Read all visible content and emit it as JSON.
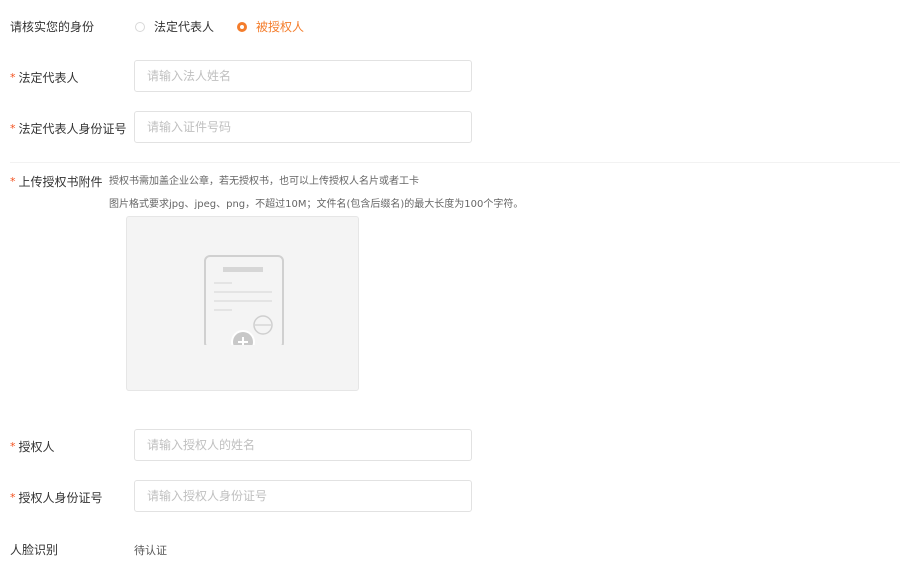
{
  "identity": {
    "label": "请核实您的身份",
    "options": [
      {
        "label": "法定代表人",
        "checked": false
      },
      {
        "label": "被授权人",
        "checked": true
      }
    ]
  },
  "legal_rep_name": {
    "required_mark": "*",
    "label": "法定代表人",
    "placeholder": "请输入法人姓名"
  },
  "legal_rep_id": {
    "required_mark": "*",
    "label": "法定代表人身份证号",
    "placeholder": "请输入证件号码"
  },
  "attachment": {
    "required_mark": "*",
    "label": "上传授权书附件",
    "hint_line1": "授权书需加盖企业公章，若无授权书，也可以上传授权人名片或者工卡",
    "hint_line2": "图片格式要求jpg、jpeg、png，不超过10M；文件名(包含后缀名)的最大长度为100个字符。",
    "icon": "document-upload-icon"
  },
  "authorized_name": {
    "required_mark": "*",
    "label": "授权人",
    "placeholder": "请输入授权人的姓名"
  },
  "authorized_id": {
    "required_mark": "*",
    "label": "授权人身份证号",
    "placeholder": "请输入授权人身份证号"
  },
  "face": {
    "label": "人脸识别",
    "status": "待认证"
  },
  "colors": {
    "accent": "#f47d2c",
    "required": "#f4511e"
  }
}
